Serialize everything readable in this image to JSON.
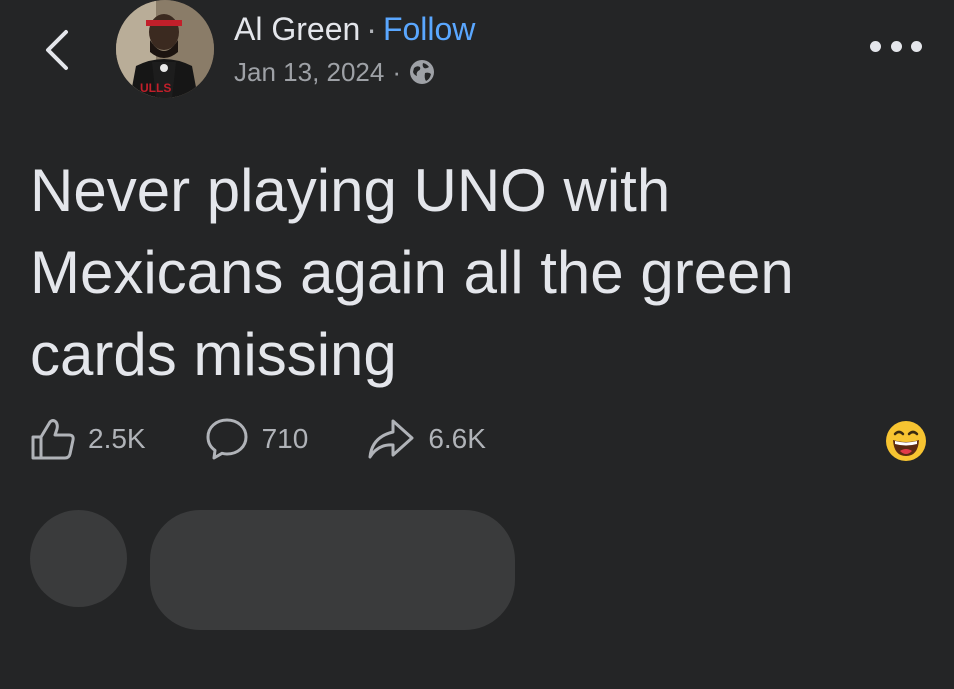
{
  "header": {
    "author_name": "Al Green",
    "separator": "·",
    "follow_label": "Follow",
    "date": "Jan 13, 2024",
    "meta_separator": "·",
    "audience_icon": "globe-icon"
  },
  "post": {
    "text": "Never playing UNO with Mexicans again all the green cards missing"
  },
  "actions": {
    "likes": "2.5K",
    "comments": "710",
    "shares": "6.6K",
    "reaction_icon": "grinning-face-emoji"
  },
  "colors": {
    "background": "#242526",
    "text": "#e4e6eb",
    "muted": "#b0b3b8",
    "link": "#5aa7ff",
    "placeholder": "#3a3b3c"
  }
}
